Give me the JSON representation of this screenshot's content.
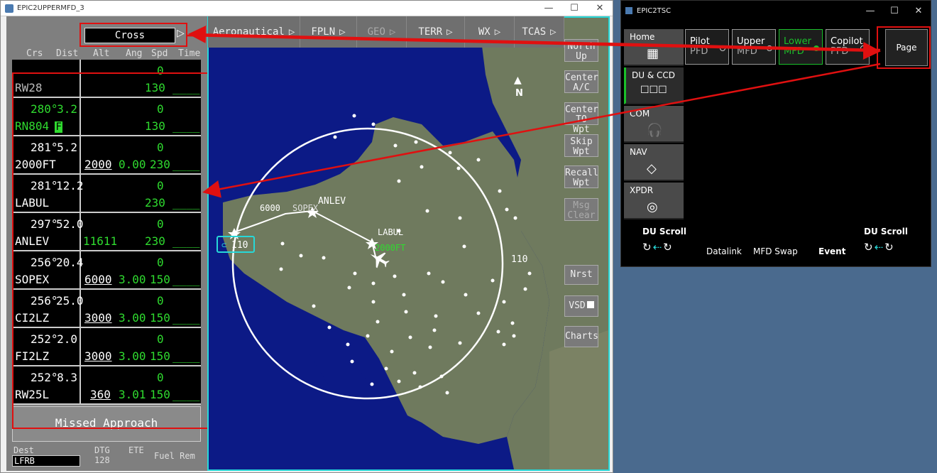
{
  "mfd_window": {
    "title": "EPIC2UPPERMFD_3",
    "minimize": "—",
    "maximize": "☐",
    "close": "✕"
  },
  "fpln": {
    "cross_label": "Cross",
    "cross_arrow": "▷",
    "headers": {
      "crs": "Crs",
      "dist": "Dist",
      "alt": "Alt",
      "ang": "Ang",
      "spd": "Spd",
      "time": "Time"
    },
    "rows": [
      {
        "crs": "",
        "dist": "",
        "ident": "RW28",
        "alt": "",
        "ang": "",
        "spd_top": "0",
        "spd": "130",
        "time": "____"
      },
      {
        "crs": "280°",
        "dist": "3.2",
        "ident": "RN804",
        "flag": "F",
        "alt": "",
        "ang": "",
        "spd_top": "0",
        "spd": "130",
        "time": "____"
      },
      {
        "crs": "281°",
        "dist": "5.2",
        "ident": "2000FT",
        "alt": "2000",
        "ang": "0.00",
        "spd_top": "0",
        "spd": "230",
        "time": "____"
      },
      {
        "crs": "281°",
        "dist": "12.2",
        "ident": "LABUL",
        "alt": "",
        "ang": "",
        "spd_top": "0",
        "spd": "230",
        "time": "____"
      },
      {
        "crs": "297°",
        "dist": "52.0",
        "ident": "ANLEV",
        "alt_green": "11611",
        "ang": "",
        "spd_top": "0",
        "spd": "230",
        "time": "____"
      },
      {
        "crs": "256°",
        "dist": "20.4",
        "ident": "SOPEX",
        "alt": "6000",
        "ang": "3.00",
        "spd_top": "0",
        "spd": "150",
        "time": "____"
      },
      {
        "crs": "256°",
        "dist": "25.0",
        "ident": "CI2LZ",
        "alt": "3000",
        "ang": "3.00",
        "spd_top": "0",
        "spd": "150",
        "time": "____"
      },
      {
        "crs": "252°",
        "dist": "2.0",
        "ident": "FI2LZ",
        "alt": "3000",
        "ang": "3.00",
        "spd_top": "0",
        "spd": "150",
        "time": "____"
      },
      {
        "crs": "252°",
        "dist": "8.3",
        "ident": "RW25L",
        "alt": "360",
        "ang": "3.01",
        "spd_top": "0",
        "spd": "150",
        "time": "____"
      }
    ],
    "missed_approach": "Missed Approach",
    "bottom": {
      "dest_label": "Dest",
      "dest_value": "LFRB",
      "dtg_label": "DTG",
      "dtg_value": "128",
      "ete_label": "ETE",
      "fuel_label": "Fuel Rem"
    }
  },
  "tabs": [
    {
      "label": "Aeronautical",
      "arrow": "▷",
      "dim": false
    },
    {
      "label": "FPLN",
      "arrow": "▷",
      "dim": false
    },
    {
      "label": "GEO",
      "arrow": "▷",
      "dim": true
    },
    {
      "label": "TERR",
      "arrow": "▷",
      "dim": false
    },
    {
      "label": "WX",
      "arrow": "▷",
      "dim": false
    },
    {
      "label": "TCAS",
      "arrow": "▷",
      "dim": false
    }
  ],
  "map_buttons": {
    "north_up": [
      "North",
      "Up"
    ],
    "center_ac": [
      "Center",
      "A/C"
    ],
    "center_to_wpt": [
      "Center",
      "TO Wpt"
    ],
    "skip_wpt": [
      "Skip",
      "Wpt"
    ],
    "recall_wpt": [
      "Recall",
      "Wpt"
    ],
    "msg_clear": [
      "Msg",
      "Clear"
    ],
    "nrst": "Nrst",
    "vsd": "VSD",
    "charts": "Charts"
  },
  "map": {
    "north_label": "N",
    "range_left": "110",
    "range_right": "110",
    "waypoints": [
      "ANLEV",
      "SOPEX",
      "6000",
      "LABUL",
      "2000FT"
    ],
    "colors": {
      "sea": "#0c1a86",
      "land": "#6f7a5e",
      "route": "#ffffff",
      "own_ship": "#2fdb2f",
      "frame": "#27d8d8"
    }
  },
  "tsc_window": {
    "title": "EPIC2TSC",
    "minimize": "—",
    "maximize": "☐",
    "close": "✕",
    "side_tabs": [
      {
        "label": "Home",
        "icon": "grid-icon"
      },
      {
        "label": "DU & CCD",
        "icon": "display-units-icon"
      },
      {
        "label": "COM",
        "icon": "headset-icon"
      },
      {
        "label": "NAV",
        "icon": "nav-diamond-icon"
      },
      {
        "label": "XPDR",
        "icon": "transponder-icon"
      }
    ],
    "du_buttons": [
      {
        "line1": "Pilot",
        "line2": "PFD"
      },
      {
        "line1": "Upper",
        "line2": "MFD"
      },
      {
        "line1": "Lower",
        "line2": "MFD"
      },
      {
        "line1": "Copilot",
        "line2": "PFD"
      }
    ],
    "page_button": "Page",
    "du_scroll_left": "DU Scroll",
    "du_scroll_right": "DU Scroll",
    "datalink": "Datalink",
    "mfd_swap": "MFD Swap",
    "event": "Event"
  }
}
